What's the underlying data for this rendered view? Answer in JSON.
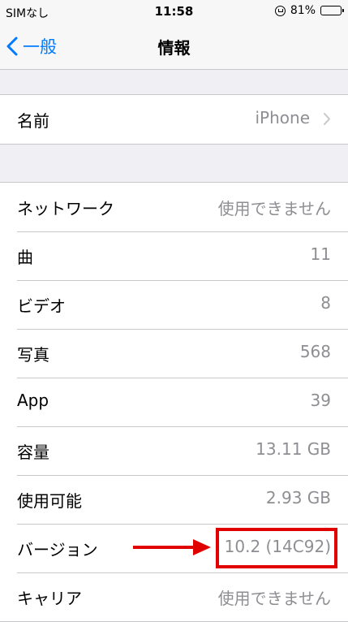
{
  "status_bar": {
    "carrier": "SIMなし",
    "time": "11:58",
    "battery": "81%",
    "battery_level": 0.81
  },
  "nav": {
    "back_label": "一般",
    "title": "情報"
  },
  "group1": [
    {
      "label": "名前",
      "value": "iPhone"
    }
  ],
  "group2": [
    {
      "label": "ネットワーク",
      "value": "使用できません"
    },
    {
      "label": "曲",
      "value": "11"
    },
    {
      "label": "ビデオ",
      "value": "8"
    },
    {
      "label": "写真",
      "value": "568"
    },
    {
      "label": "App",
      "value": "39"
    },
    {
      "label": "容量",
      "value": "13.11 GB"
    },
    {
      "label": "使用可能",
      "value": "2.93 GB"
    },
    {
      "label": "バージョン",
      "value": "10.2 (14C92)"
    },
    {
      "label": "キャリア",
      "value": "使用できません"
    }
  ],
  "colors": {
    "accent": "#007aff",
    "annotation": "#e00000"
  }
}
